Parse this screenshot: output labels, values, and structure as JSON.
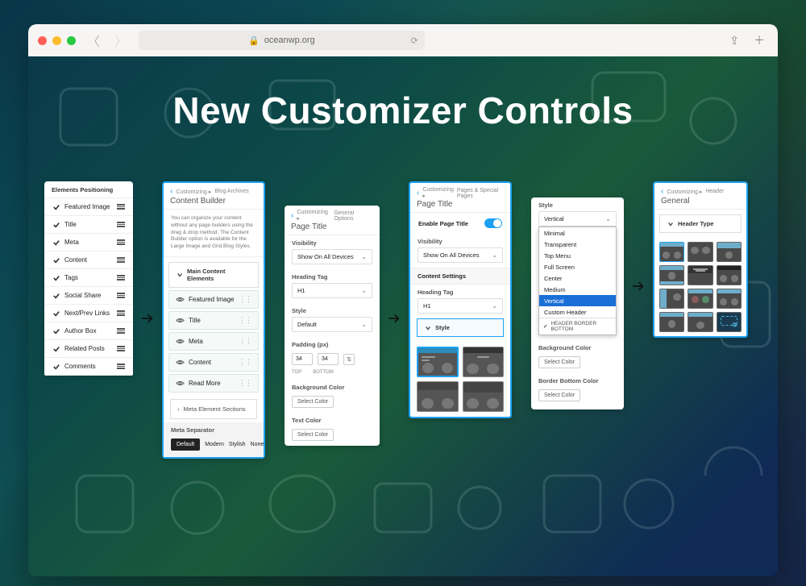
{
  "browser": {
    "url": "oceanwp.org"
  },
  "hero": "New Customizer Controls",
  "panel1_left": {
    "title": "Elements Positioning",
    "items": [
      "Featured Image",
      "Title",
      "Meta",
      "Content",
      "Tags",
      "Social Share",
      "Next/Prev Links",
      "Author Box",
      "Related Posts",
      "Comments"
    ]
  },
  "panel1_right": {
    "breadcrumb_a": "Customizing ▸",
    "breadcrumb_b": "Blog Archives",
    "title": "Content Builder",
    "description": "You can organize your content without any page builders using the drag & drop method. The Content Builder option is available for the Large Image and Grid Blog Styles.",
    "section": "Main Content Elements",
    "items": [
      "Featured Image",
      "Title",
      "Meta",
      "Content",
      "Read More"
    ],
    "meta_sections": "Meta Element Sections",
    "separator_label": "Meta Separator",
    "separator_opts": [
      "Default",
      "Modern",
      "Stylish",
      "None"
    ]
  },
  "panel2_left": {
    "breadcrumb_a": "Customizing ▸",
    "breadcrumb_b": "General Options",
    "title": "Page Title",
    "visibility_label": "Visibility",
    "visibility_value": "Show On All Devices",
    "heading_label": "Heading Tag",
    "heading_value": "H1",
    "style_label": "Style",
    "style_value": "Default",
    "padding_label": "Padding (px)",
    "padding_top": "34",
    "padding_bottom": "34",
    "padding_cap_top": "TOP",
    "padding_cap_bottom": "BOTTOM",
    "bgcolor_label": "Background Color",
    "textcolor_label": "Text Color",
    "select_color": "Select Color"
  },
  "panel2_right": {
    "breadcrumb_a": "Customizing ▸",
    "breadcrumb_b": "Pages & Special Pages",
    "title": "Page Title",
    "enable_label": "Enable Page Title",
    "visibility_label": "Visibility",
    "visibility_value": "Show On All Devices",
    "content_settings": "Content Settings",
    "heading_label": "Heading Tag",
    "heading_value": "H1",
    "style_section": "Style"
  },
  "panel3_left": {
    "style_label": "Style",
    "style_value": "Vertical",
    "options": [
      "Minimal",
      "Transparent",
      "Top Menu",
      "Full Screen",
      "Center",
      "Medium",
      "Vertical",
      "Custom Header"
    ],
    "checkbox": "HEADER BORDER BOTTOM",
    "bgcolor_label": "Background Color",
    "border_label": "Border Bottom Color",
    "select_color": "Select Color"
  },
  "panel3_right": {
    "breadcrumb_a": "Customizing ▸",
    "breadcrumb_b": "Header",
    "title": "General",
    "section": "Header Type"
  }
}
